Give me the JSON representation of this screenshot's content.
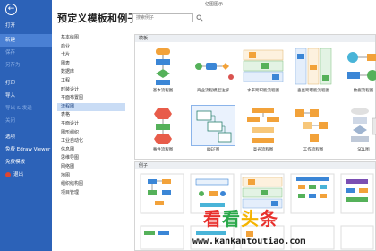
{
  "window": {
    "title": "亿图图示"
  },
  "sidebar": {
    "back_label": "打开",
    "items": [
      {
        "label": "新建",
        "state": "active"
      },
      {
        "label": "保存",
        "state": "dim"
      },
      {
        "label": "另存为",
        "state": "dim"
      },
      {
        "label": "打印",
        "state": "normal"
      },
      {
        "label": "导入",
        "state": "normal"
      },
      {
        "label": "导出 & 发送",
        "state": "dim"
      },
      {
        "label": "关闭",
        "state": "dim"
      },
      {
        "label": "选项",
        "state": "normal"
      },
      {
        "label": "免费 Edraw Viewer",
        "state": "normal"
      },
      {
        "label": "免费模板",
        "state": "normal"
      },
      {
        "label": "退出",
        "state": "normal"
      }
    ]
  },
  "main": {
    "heading": "预定义模板和例子",
    "search_placeholder": "搜索例子"
  },
  "categories": [
    {
      "label": "基本绘图",
      "active": false
    },
    {
      "label": "商业",
      "active": false
    },
    {
      "label": "卡片",
      "active": false
    },
    {
      "label": "图表",
      "active": false
    },
    {
      "label": "数据库",
      "active": false
    },
    {
      "label": "工程",
      "active": false
    },
    {
      "label": "时装设计",
      "active": false
    },
    {
      "label": "平面布置图",
      "active": false
    },
    {
      "label": "流程图",
      "active": true
    },
    {
      "label": "表格",
      "active": false
    },
    {
      "label": "平面设计",
      "active": false
    },
    {
      "label": "图形组织",
      "active": false
    },
    {
      "label": "工业自动化",
      "active": false
    },
    {
      "label": "信息图",
      "active": false
    },
    {
      "label": "思维导图",
      "active": false
    },
    {
      "label": "网络图",
      "active": false
    },
    {
      "label": "地图",
      "active": false
    },
    {
      "label": "组织结构图",
      "active": false
    },
    {
      "label": "项目管理",
      "active": false
    }
  ],
  "templates_panel": {
    "title": "模板",
    "items": [
      {
        "label": "基本流程图",
        "icon": "basic-flowchart-icon",
        "selected": false
      },
      {
        "label": "商业流程模型注解",
        "icon": "bpmn-icon",
        "selected": false
      },
      {
        "label": "水平跨职能流程图",
        "icon": "horizontal-cross-functional-icon",
        "selected": false
      },
      {
        "label": "垂直跨职能流程图",
        "icon": "vertical-cross-functional-icon",
        "selected": false
      },
      {
        "label": "数据流程图",
        "icon": "data-flow-icon",
        "selected": false
      },
      {
        "label": "事件流程图",
        "icon": "event-flowchart-icon",
        "selected": false
      },
      {
        "label": "IDEF图",
        "icon": "idef-icon",
        "selected": true
      },
      {
        "label": "高光流程图",
        "icon": "highlight-flowchart-icon",
        "selected": false
      },
      {
        "label": "工作流程图",
        "icon": "workflow-icon",
        "selected": false
      },
      {
        "label": "SDL图",
        "icon": "sdl-icon",
        "selected": false
      }
    ]
  },
  "examples_panel": {
    "title": "例子"
  },
  "watermark": {
    "title": "看看头条",
    "url": "www.kankantoutiao.com",
    "colors": {
      "red": "#e8302c",
      "green": "#2aa84a",
      "yellow": "#f5b400"
    }
  },
  "colors": {
    "sidebar_bg": "#2c62b8",
    "sidebar_active": "#4a80d4",
    "category_active_bg": "#c9dcf5",
    "shape_orange": "#f2a23a",
    "shape_blue": "#3b86d6",
    "shape_green": "#55b15a",
    "shape_cyan": "#49b4d8"
  }
}
